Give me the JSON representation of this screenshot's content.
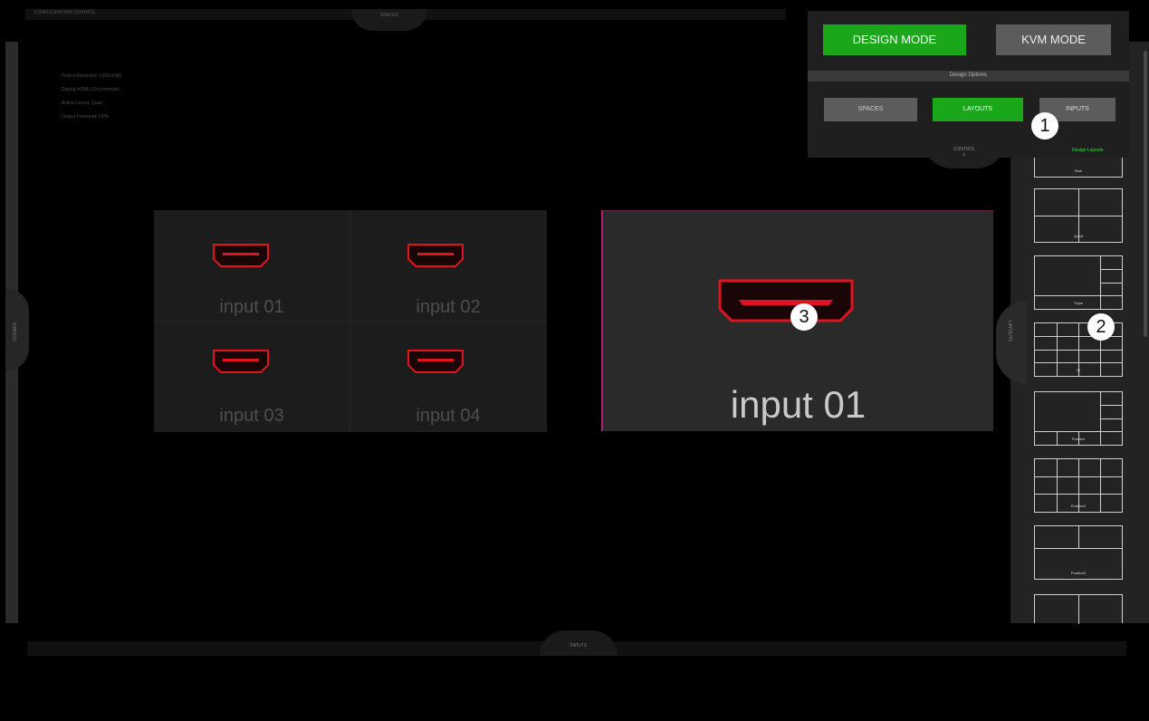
{
  "top_bar": {
    "title": "CONFIGURATION CONTROL",
    "tab_label": "SPACES"
  },
  "left_tab": {
    "label": "SCENES"
  },
  "info": {
    "lines": [
      "Output Resolution 1920x1080",
      "Display HDMI 2.0 connected",
      "Active Layout: Quad",
      "Output Framerate 60Hz"
    ]
  },
  "preview_quad": {
    "cells": [
      {
        "label": "input 01"
      },
      {
        "label": "input 02"
      },
      {
        "label": "input 03"
      },
      {
        "label": "input 04"
      }
    ]
  },
  "preview_single": {
    "label": "input 01"
  },
  "control_panel": {
    "design_mode": "DESIGN MODE",
    "kvm_mode": "KVM MODE",
    "design_options": "Design Options",
    "spaces": "SPACES",
    "layouts": "LAYOUTS",
    "inputs": "INPUTS",
    "tab_label_line1": "CONTROL",
    "tab_label_line2": "∨",
    "design_layouts": "Design Layouts"
  },
  "right_tab": {
    "label": "LAYOUTS"
  },
  "layouts": [
    {
      "label": "Row"
    },
    {
      "label": "Quad"
    },
    {
      "label": "Triple"
    },
    {
      "label": "16"
    },
    {
      "label": "Position"
    },
    {
      "label": "Position2"
    },
    {
      "label": "Position3"
    },
    {
      "label": ""
    }
  ],
  "bottom_bar": {
    "tab_label": "INPUTS"
  },
  "badges": [
    "1",
    "2",
    "3"
  ],
  "colors": {
    "accent_green": "#1aa81a",
    "hdmi_red": "#e0141e",
    "selection_magenta": "#b0206a"
  }
}
